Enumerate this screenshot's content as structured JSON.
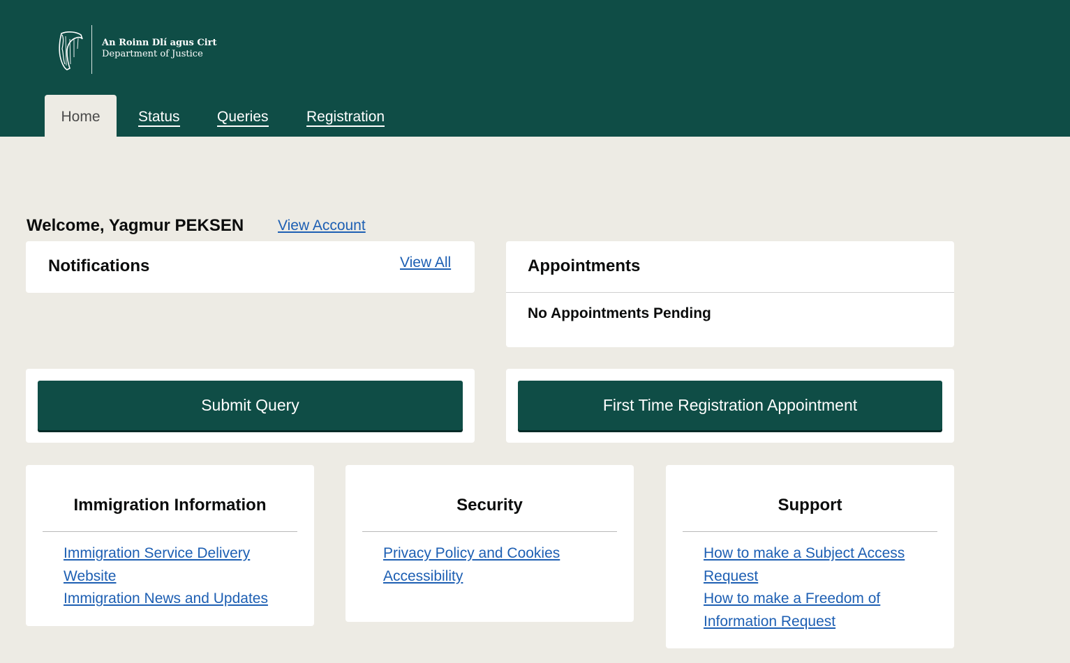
{
  "header": {
    "logo_irish": "An Roinn Dlí agus Cirt",
    "logo_english": "Department of Justice",
    "logo_icon": "harp-icon",
    "nav": {
      "home": "Home",
      "status": "Status",
      "queries": "Queries",
      "registration": "Registration"
    }
  },
  "welcome": {
    "text": "Welcome, Yagmur PEKSEN",
    "view_account": "View Account"
  },
  "notifications": {
    "title": "Notifications",
    "view_all": "View All"
  },
  "appointments": {
    "title": "Appointments",
    "status": "No Appointments Pending"
  },
  "actions": {
    "submit_query": "Submit Query",
    "first_time_registration": "First Time Registration Appointment"
  },
  "info_cards": {
    "immigration": {
      "title": "Immigration Information",
      "links": [
        "Immigration Service Delivery Website",
        "Immigration News and Updates"
      ]
    },
    "security": {
      "title": "Security",
      "links": [
        "Privacy Policy and Cookies",
        "Accessibility"
      ]
    },
    "support": {
      "title": "Support",
      "links": [
        "How to make a Subject Access Request",
        "How to make a Freedom of Information Request"
      ]
    }
  },
  "colors": {
    "brand_green": "#0f4d46",
    "page_background": "#edebe4",
    "link_blue": "#1d5fb3"
  }
}
